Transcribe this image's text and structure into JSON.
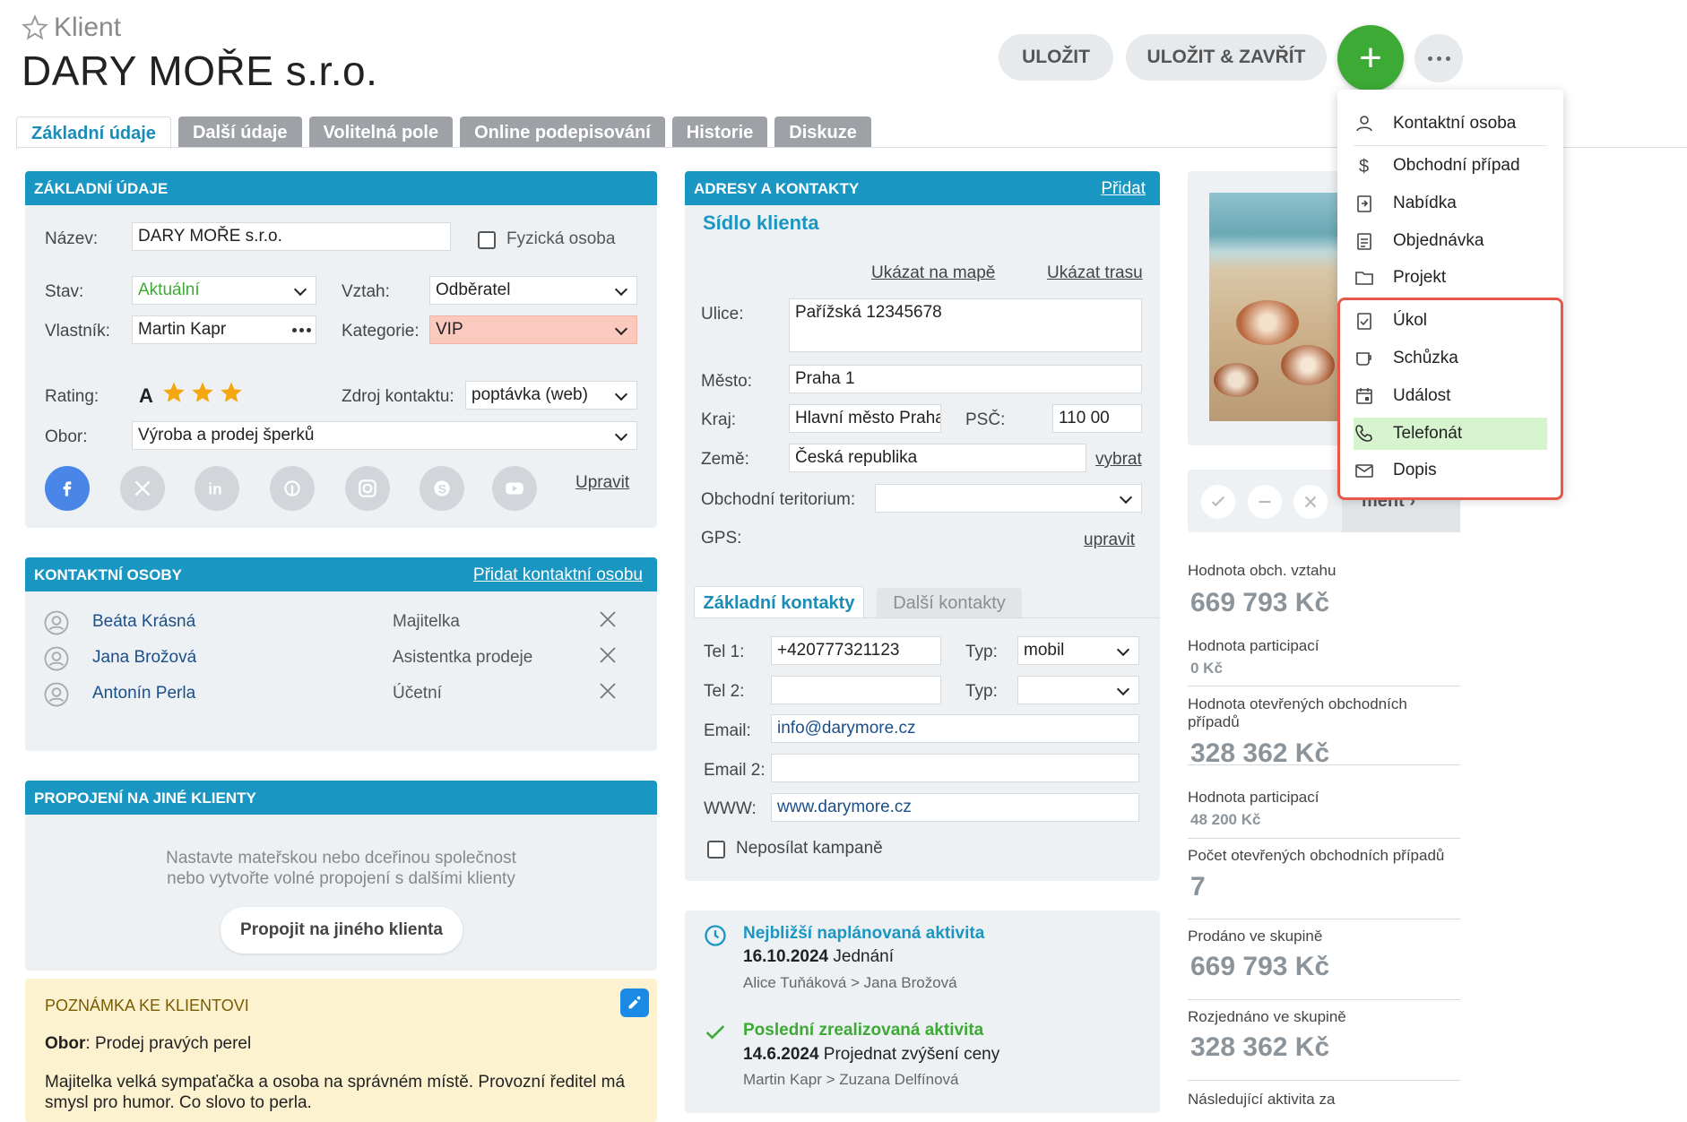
{
  "header": {
    "entity_type": "Klient",
    "title": "DARY MOŘE s.r.o.",
    "save": "ULOŽIT",
    "save_close": "ULOŽIT & ZAVŘÍT",
    "add": "+"
  },
  "tabs": [
    "Základní údaje",
    "Další údaje",
    "Volitelná pole",
    "Online podepisování",
    "Historie",
    "Diskuze"
  ],
  "basic": {
    "title": "ZÁKLADNÍ ÚDAJE",
    "name_label": "Název:",
    "name_value": "DARY MOŘE s.r.o.",
    "physical_label": "Fyzická osoba",
    "status_label": "Stav:",
    "status_value": "Aktuální",
    "relation_label": "Vztah:",
    "relation_value": "Odběratel",
    "owner_label": "Vlastník:",
    "owner_value": "Martin Kapr",
    "category_label": "Kategorie:",
    "category_value": "VIP",
    "rating_label": "Rating:",
    "rating_value": "A",
    "rating_stars": 3,
    "source_label": "Zdroj kontaktu:",
    "source_value": "poptávka (web)",
    "field_label": "Obor:",
    "field_value": "Výroba a prodej šperků",
    "edit_link": "Upravit",
    "social": [
      "facebook-icon",
      "x-icon",
      "linkedin-icon",
      "pinterest-icon",
      "instagram-icon",
      "skype-icon",
      "youtube-icon"
    ]
  },
  "contacts": {
    "title": "KONTAKTNÍ OSOBY",
    "add_link": "Přidat kontaktní osobu",
    "items": [
      {
        "name": "Beáta Krásná",
        "role": "Majitelka"
      },
      {
        "name": "Jana Brožová",
        "role": "Asistentka prodeje"
      },
      {
        "name": "Antonín Perla",
        "role": "Účetní"
      }
    ]
  },
  "links": {
    "title": "PROPOJENÍ NA JINÉ KLIENTY",
    "hint1": "Nastavte mateřskou nebo dceřinou společnost",
    "hint2": "nebo vytvořte volné propojení s dalšími klienty",
    "button": "Propojit na jiného klienta"
  },
  "note": {
    "title": "POZNÁMKA KE KLIENTOVI",
    "field_label": "Obor",
    "field_value": ": Prodej pravých perel",
    "text": "Majitelka velká sympaťačka a osoba na správném místě. Provozní ředitel má smysl pro humor. Co slovo to perla."
  },
  "address": {
    "title": "ADRESY A KONTAKTY",
    "add_link": "Přidat",
    "subtitle": "Sídlo klienta",
    "map_link": "Ukázat na mapě",
    "route_link": "Ukázat trasu",
    "street_label": "Ulice:",
    "street_value": "Pařížská  12345678",
    "city_label": "Město:",
    "city_value": "Praha 1",
    "region_label": "Kraj:",
    "region_value": "Hlavní město Praha",
    "zip_label": "PSČ:",
    "zip_value": "110 00",
    "country_label": "Země:",
    "country_value": "Česká republika",
    "choose_link": "vybrat",
    "territory_label": "Obchodní teritorium:",
    "gps_label": "GPS:",
    "gps_link": "upravit"
  },
  "ctabs": [
    "Základní kontakty",
    "Další kontakty"
  ],
  "ccontacts": {
    "tel1_label": "Tel 1:",
    "tel1_value": "+420777321123",
    "type_label": "Typ:",
    "type1_value": "mobil",
    "tel2_label": "Tel 2:",
    "type2_label": "Typ:",
    "email_label": "Email:",
    "email_value": "info@darymore.cz",
    "email2_label": "Email 2:",
    "www_label": "WWW:",
    "www_value": "www.darymore.cz",
    "nocampaign_label": "Neposílat kampaně"
  },
  "activity": {
    "next_title": "Nejbližší naplánovaná aktivita",
    "next_date": "16.10.2024",
    "next_name": " Jednání",
    "next_people": "Alice Tuňáková > Jana Brožová",
    "last_title": "Poslední zrealizovaná aktivita",
    "last_date": "14.6.2024",
    "last_name": " Projednat zvýšení ceny",
    "last_people": "Martin Kapr > Zuzana Delfínová"
  },
  "stats": [
    {
      "label": "Hodnota obch. vztahu",
      "value": "669 793 Kč"
    },
    {
      "label": "Hodnota participací",
      "value": "0 Kč"
    },
    {
      "label": "Hodnota otevřených obchodních",
      "label2": "případů",
      "value": "328 362 Kč"
    },
    {
      "label": "Hodnota participací",
      "value": "48 200 Kč"
    },
    {
      "label": "Počet otevřených obchodních případů",
      "value": "7"
    },
    {
      "label": "Prodáno ve skupině",
      "value": "669 793 Kč"
    },
    {
      "label": "Rozjednáno ve skupině",
      "value": "328 362 Kč"
    },
    {
      "label": "Následující aktivita za"
    }
  ],
  "image_panel": {
    "partial_text": "ment ›"
  },
  "dropdown": [
    {
      "label": "Kontaktní osoba",
      "icon": "person-icon"
    },
    {
      "label": "Obchodní případ",
      "icon": "dollar-icon"
    },
    {
      "label": "Nabídka",
      "icon": "offer-icon"
    },
    {
      "label": "Objednávka",
      "icon": "order-icon"
    },
    {
      "label": "Projekt",
      "icon": "folder-icon"
    },
    {
      "label": "Úkol",
      "icon": "task-icon"
    },
    {
      "label": "Schůzka",
      "icon": "meeting-icon"
    },
    {
      "label": "Událost",
      "icon": "calendar-icon"
    },
    {
      "label": "Telefonát",
      "icon": "phone-icon"
    },
    {
      "label": "Dopis",
      "icon": "letter-icon"
    }
  ],
  "colors": {
    "accent": "#1a96c3",
    "add": "#3daa35",
    "highlight": "#d6f5cf",
    "callout": "#e8584a",
    "note_bg": "#fdf2d0"
  }
}
